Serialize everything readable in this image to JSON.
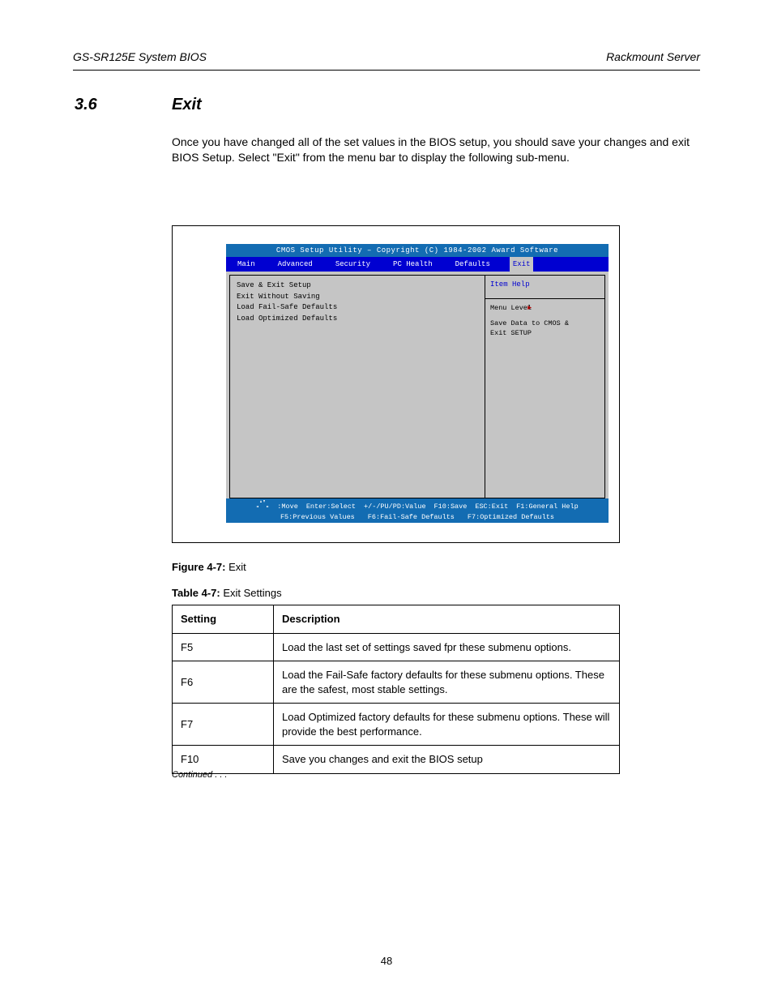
{
  "header": {
    "left": "GS-SR125E System BIOS",
    "right": "Rackmount Server"
  },
  "section": {
    "number": "3.6",
    "title": "Exit"
  },
  "intro": "Once you have changed all of the set values in the BIOS setup, you should save your changes and exit BIOS Setup. Select \"Exit\" from the menu bar to display the following sub-menu.",
  "bios": {
    "title": "CMOS Setup Utility – Copyright (C) 1984-2002 Award Software",
    "tabs": [
      "Main",
      "Advanced",
      "Security",
      "PC Health",
      "Defaults",
      "Exit"
    ],
    "active_tab_index": 5,
    "menu_items": [
      {
        "label": "Save & Exit Setup",
        "value": ""
      },
      {
        "label": "Exit Without Saving",
        "value": ""
      },
      {
        "label": "Load Fail-Safe Defaults",
        "value": ""
      },
      {
        "label": "Load Optimized Defaults",
        "value": ""
      }
    ],
    "help_header": "Item Help",
    "help_rows": [
      {
        "k": "Menu Level",
        "v": ""
      },
      {
        "k": "",
        "v": "Save Data to CMOS &"
      },
      {
        "k": "",
        "v": "Exit SETUP"
      }
    ],
    "footer": {
      "cells": [
        [
          ":Move",
          "Enter:Select",
          "+/-/PU/PD:Value",
          "F10:Save",
          "ESC:Exit",
          "F1:General Help"
        ],
        [
          "F5:Previous Values",
          "F6:Fail-Safe Defaults",
          "F7:Optimized Defaults"
        ]
      ]
    }
  },
  "figure": {
    "caption_bold": "Figure 4-7:",
    "caption_rest": " Exit"
  },
  "table": {
    "title_bold": "Table 4-7:",
    "title_rest": " Exit Settings",
    "headers": [
      "Setting",
      "Description"
    ],
    "rows": [
      [
        "F5",
        "Load the last set of settings saved fpr these submenu options."
      ],
      [
        "F6",
        "Load the Fail-Safe factory defaults for these submenu options. These are the safest, most stable settings."
      ],
      [
        "F7",
        "Load Optimized factory defaults for these submenu options. These will provide the best performance."
      ],
      [
        "F10",
        "Save you changes and exit the BIOS setup"
      ]
    ]
  },
  "continued": "Continued . . .",
  "page_number": "48"
}
